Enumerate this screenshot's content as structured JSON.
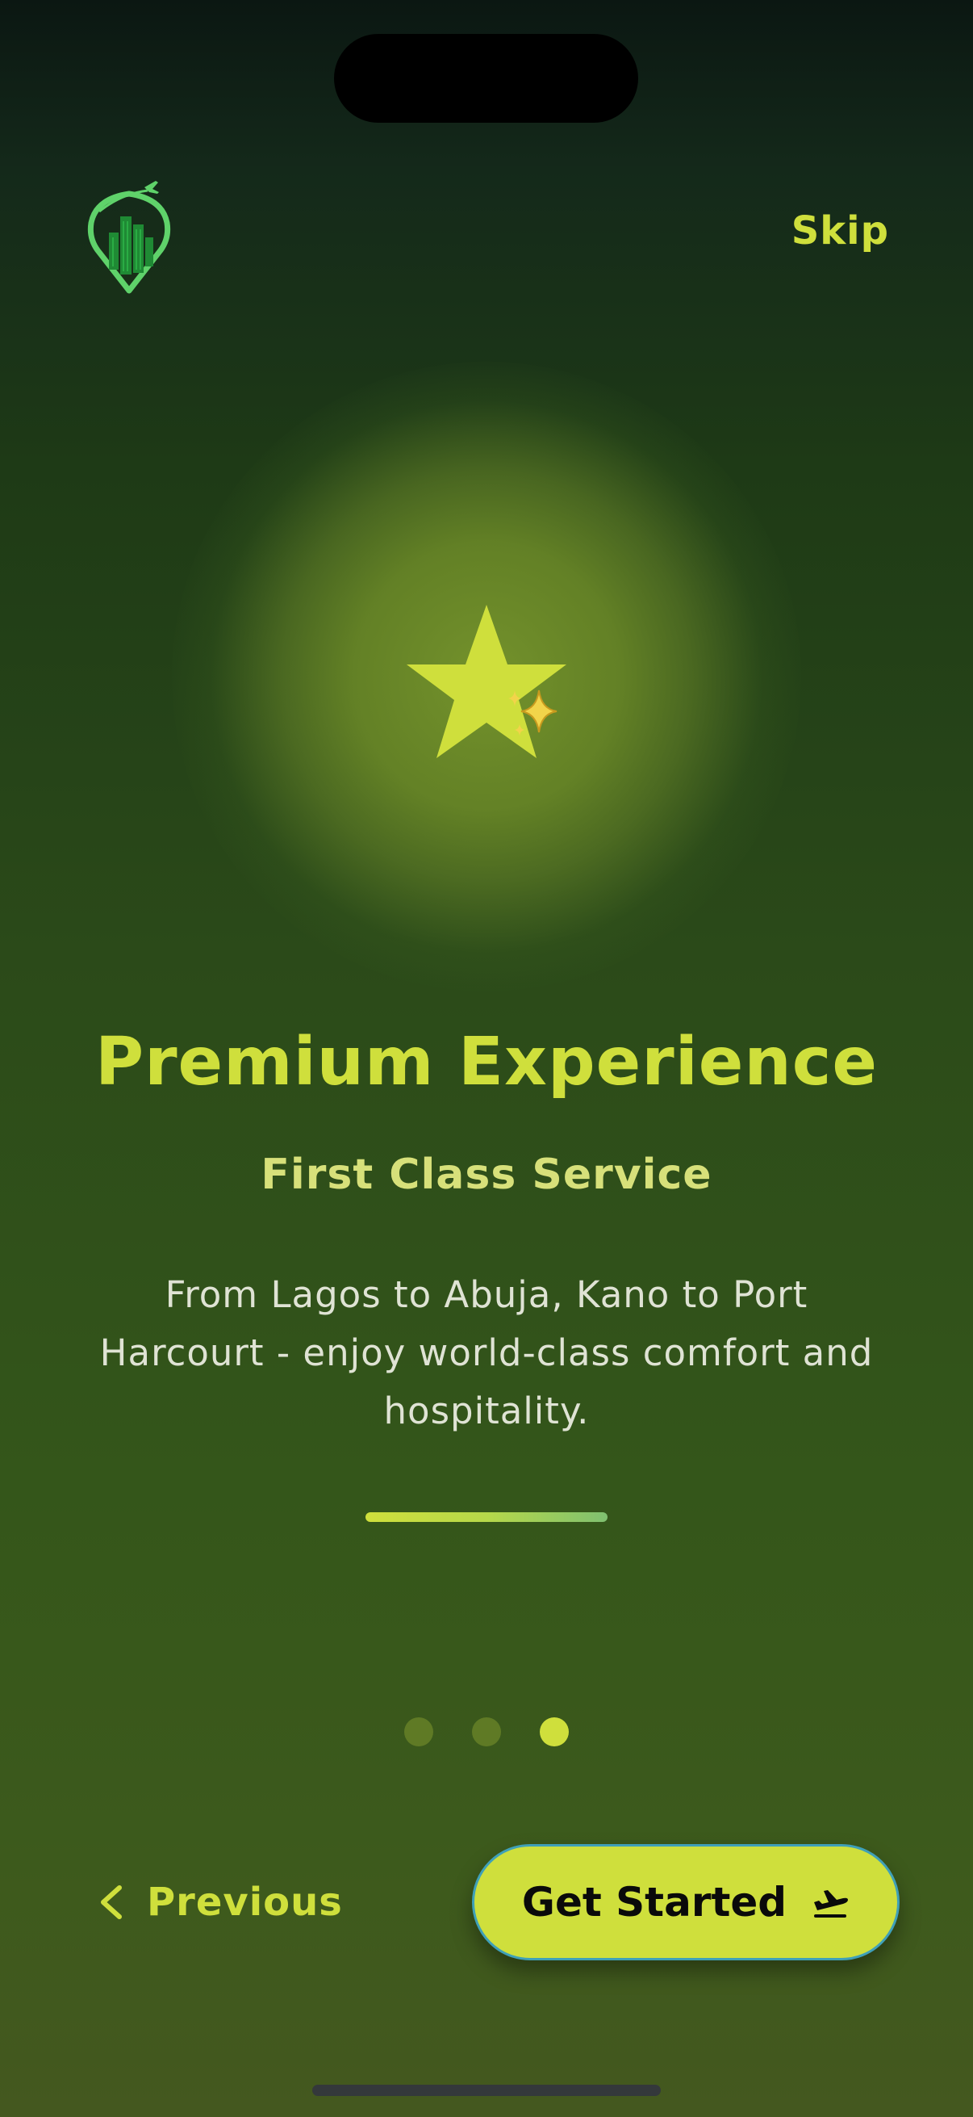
{
  "header": {
    "logo_icon": "map-pin-buildings-plane-icon",
    "skip_label": "Skip"
  },
  "hero": {
    "icon": "star-sparkle-icon"
  },
  "content": {
    "title": "Premium Experience",
    "subtitle": "First Class Service",
    "description": "From Lagos to Abuja, Kano to Port Harcourt - enjoy world-class comfort and hospitality."
  },
  "pagination": {
    "total": 3,
    "current": 3
  },
  "footer": {
    "previous_label": "Previous",
    "previous_icon": "chevron-left-icon",
    "cta_label": "Get Started",
    "cta_icon": "plane-departure-icon"
  },
  "colors": {
    "accent": "#cfdf3c",
    "background_top": "#0b1712",
    "background_bottom": "#44581f",
    "logo_green": "#5fd26a",
    "cta_border": "#3fa0b8"
  }
}
